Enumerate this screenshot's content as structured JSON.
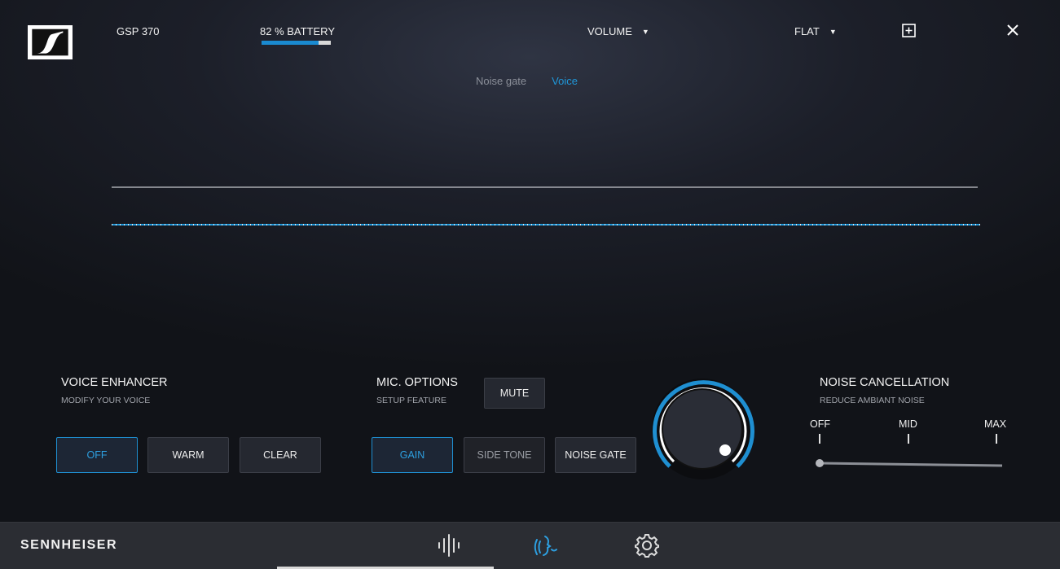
{
  "header": {
    "device_name": "GSP 370",
    "battery_label": "82 % BATTERY",
    "battery_level": 0.82,
    "volume_label": "VOLUME",
    "preset_label": "FLAT"
  },
  "graph": {
    "tabs": [
      {
        "label": "Noise gate",
        "active": false
      },
      {
        "label": "Voice",
        "active": true
      }
    ]
  },
  "voice_enhancer": {
    "title": "VOICE ENHANCER",
    "subtitle": "MODIFY YOUR VOICE",
    "buttons": [
      "OFF",
      "WARM",
      "CLEAR"
    ],
    "selected": "OFF"
  },
  "mic_options": {
    "title": "MIC. OPTIONS",
    "subtitle": "SETUP FEATURE",
    "mute_label": "MUTE",
    "buttons": [
      "GAIN",
      "SIDE TONE",
      "NOISE GATE"
    ],
    "selected": "GAIN"
  },
  "noise_cancellation": {
    "title": "NOISE CANCELLATION",
    "subtitle": "REDUCE AMBIANT NOISE",
    "labels": [
      "OFF",
      "MID",
      "MAX"
    ],
    "value": "OFF"
  },
  "footer": {
    "brand": "SENNHEISER",
    "nav": [
      "equalizer-icon",
      "microphone-icon",
      "settings-icon"
    ]
  },
  "colors": {
    "accent": "#1f97d8",
    "background": "#1c1f29",
    "footer": "#2b2d33"
  }
}
